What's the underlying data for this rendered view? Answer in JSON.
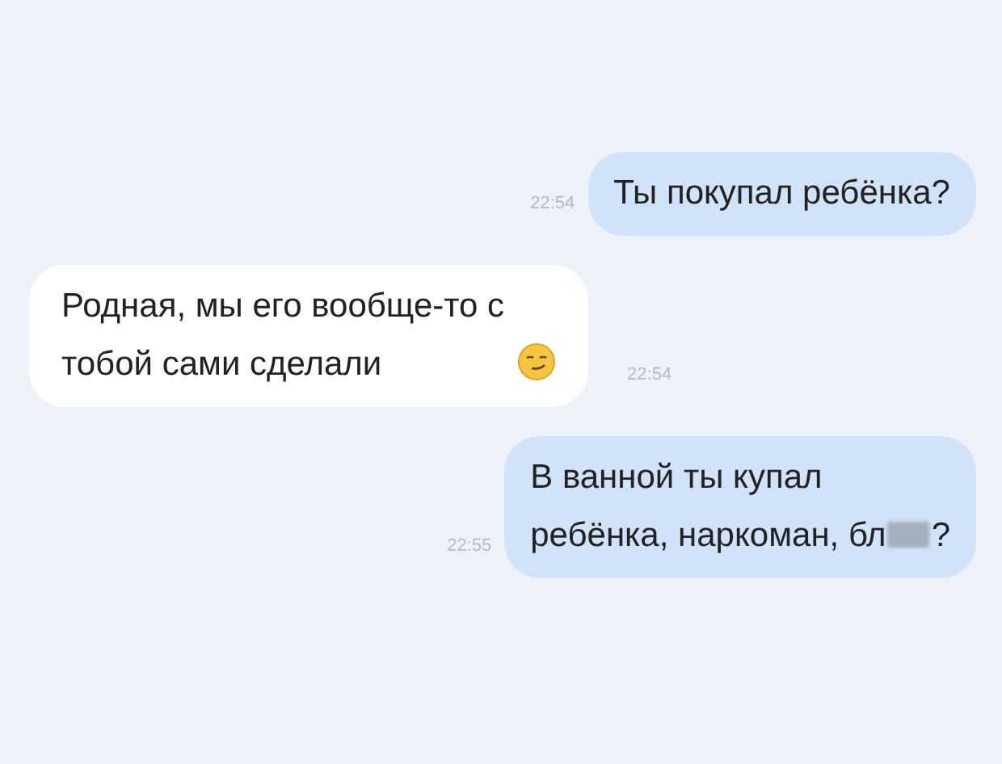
{
  "messages": [
    {
      "kind": "outgoing",
      "text": "Ты покупал ребёнка?",
      "time": "22:54",
      "emoji": false,
      "censored": false
    },
    {
      "kind": "incoming",
      "text": "Родная, мы его вообще-то с\nтобой сами сделали",
      "time": "22:54",
      "emoji": true,
      "censored": false
    },
    {
      "kind": "outgoing",
      "text": "В ванной ты купал\nребёнка, наркоман, бл",
      "text_after": "?",
      "time": "22:55",
      "emoji": false,
      "censored": true
    }
  ]
}
